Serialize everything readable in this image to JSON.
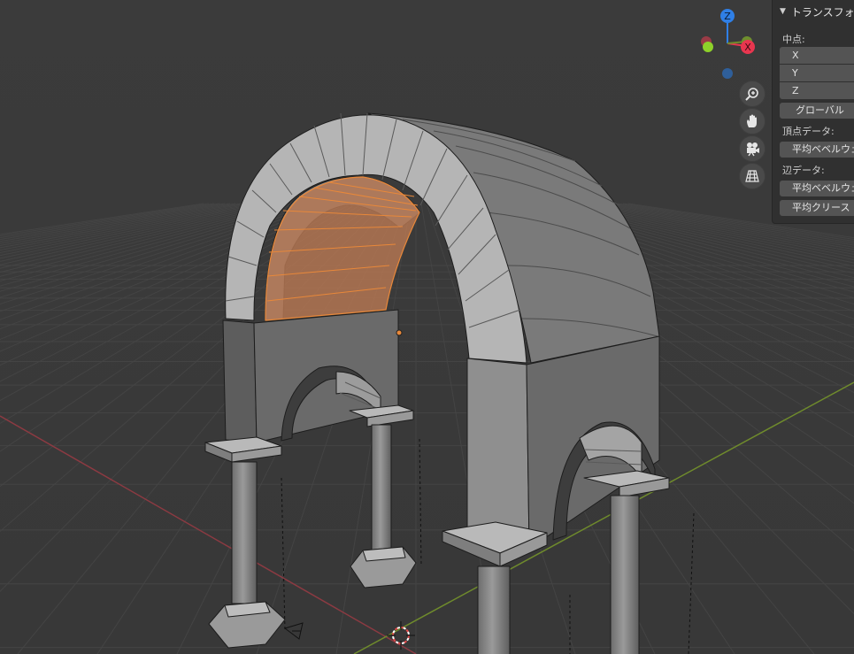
{
  "viewport": {
    "gizmo": {
      "z_label": "Z",
      "x_label": "X"
    },
    "nav_buttons": [
      {
        "name": "zoom-icon"
      },
      {
        "name": "pan-hand-icon"
      },
      {
        "name": "camera-view-icon"
      },
      {
        "name": "orthographic-grid-icon"
      }
    ]
  },
  "panel": {
    "title": "トランスフォーム",
    "median_label": "中点:",
    "axes": [
      "X",
      "Y",
      "Z"
    ],
    "global_button": "グローバル",
    "vertex_data_label": "頂点データ:",
    "vertex_bevel_weight": "平均ベベルウェイト",
    "edge_data_label": "辺データ:",
    "edge_bevel_weight": "平均ベベルウェイト",
    "edge_crease": "平均クリース"
  },
  "colors": {
    "background": "#3a3a3a",
    "axis_x": "#8c3a42",
    "axis_y": "#6f8b2c",
    "gizmo_z": "#2f7fe6",
    "gizmo_x": "#e8364f",
    "gizmo_y": "#8ed12a",
    "selection": "#e8883a"
  }
}
